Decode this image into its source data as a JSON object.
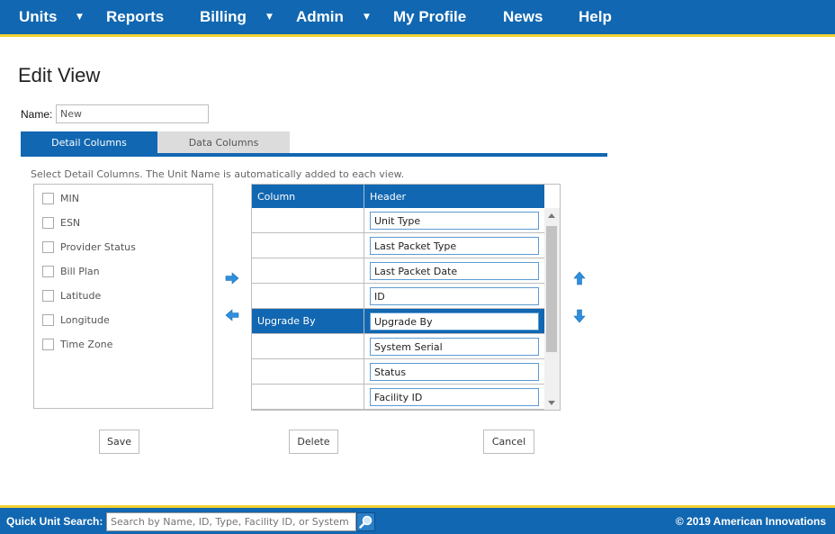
{
  "nav": {
    "units": "Units",
    "reports": "Reports",
    "billing": "Billing",
    "admin": "Admin",
    "my_profile": "My Profile",
    "news": "News",
    "help": "Help",
    "caret": "▼"
  },
  "page": {
    "title": "Edit View",
    "name_label": "Name:",
    "name_value": "New"
  },
  "tabs": {
    "detail": "Detail Columns",
    "data": "Data Columns"
  },
  "instructions": "Select Detail Columns. The Unit Name is automatically added to each view.",
  "available": [
    "MIN",
    "ESN",
    "Provider Status",
    "Bill Plan",
    "Latitude",
    "Longitude",
    "Time Zone"
  ],
  "grid": {
    "col_header": "Column",
    "hdr_header": "Header",
    "rows": [
      {
        "column": "",
        "header": "Unit Type"
      },
      {
        "column": "",
        "header": "Last Packet Type"
      },
      {
        "column": "",
        "header": "Last Packet Date"
      },
      {
        "column": "",
        "header": "ID"
      },
      {
        "column": "Upgrade By",
        "header": "Upgrade By"
      },
      {
        "column": "",
        "header": "System Serial"
      },
      {
        "column": "",
        "header": "Status"
      },
      {
        "column": "",
        "header": "Facility ID"
      }
    ]
  },
  "buttons": {
    "save": "Save",
    "delete": "Delete",
    "cancel": "Cancel"
  },
  "footer": {
    "quick_search_label": "Quick Unit Search:",
    "quick_search_placeholder": "Search by Name, ID, Type, Facility ID, or System Serial",
    "copyright": "© 2019 American Innovations"
  },
  "colors": {
    "primary": "#1167b1",
    "accent": "#f2d230",
    "arrow": "#2f8fdc"
  },
  "icons": {
    "add": "arrow-right-icon",
    "remove": "arrow-left-icon",
    "move_up": "arrow-up-icon",
    "move_down": "arrow-down-icon",
    "search": "magnifier-icon"
  }
}
